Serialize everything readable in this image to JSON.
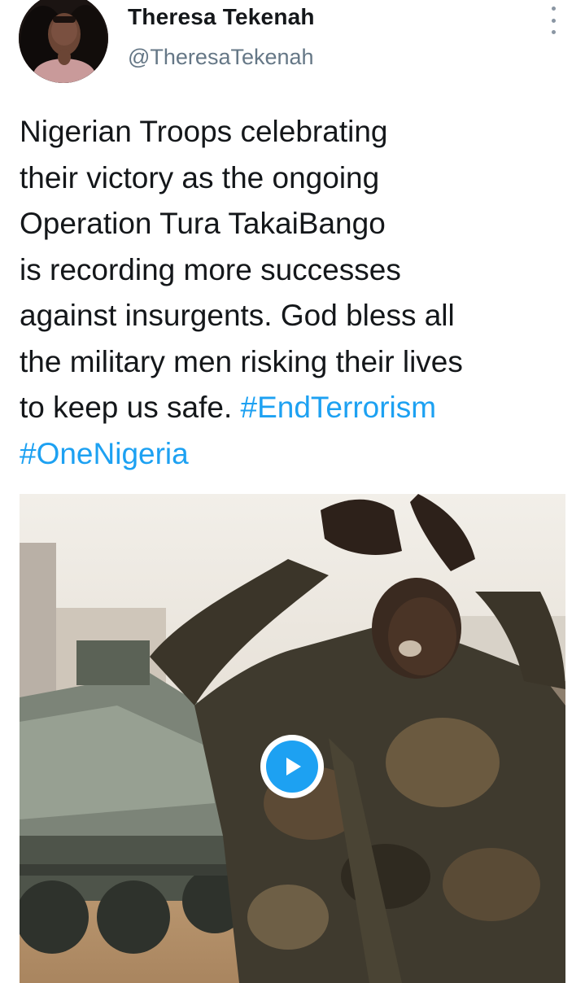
{
  "author": {
    "display_name": "Theresa Tekenah",
    "handle": "@TheresaTekenah"
  },
  "menu": {
    "icon": "more-vertical-icon"
  },
  "tweet": {
    "lines": [
      "Nigerian Troops celebrating",
      "their victory as the ongoing",
      "Operation Tura TakaiBango",
      "is recording more successes",
      "against insurgents. God bless all",
      "the military men risking their lives"
    ],
    "last_line_text": "to keep us safe. ",
    "hashtags": [
      "#EndTerrorism",
      "#OneNigeria"
    ]
  },
  "media": {
    "type": "video",
    "play_icon": "play-icon"
  },
  "colors": {
    "link": "#1da1f2",
    "text": "#14171a",
    "secondary": "#657786"
  }
}
